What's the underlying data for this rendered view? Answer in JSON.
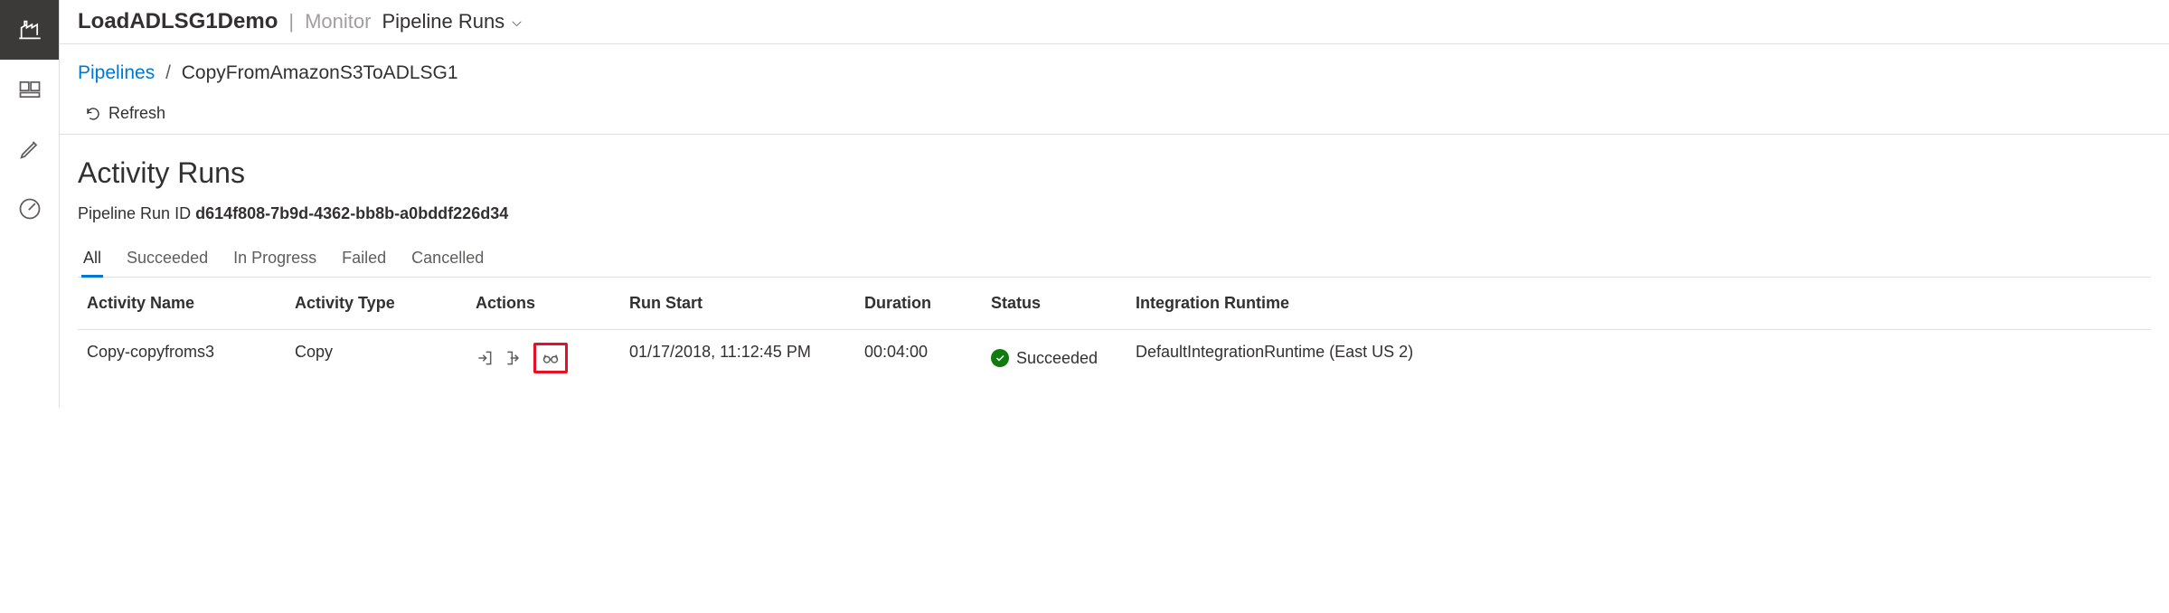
{
  "header": {
    "title": "LoadADLSG1Demo",
    "subtitle": "Monitor",
    "dropdown_label": "Pipeline Runs"
  },
  "breadcrumb": {
    "link": "Pipelines",
    "separator": "/",
    "current": "CopyFromAmazonS3ToADLSG1"
  },
  "toolbar": {
    "refresh_label": "Refresh"
  },
  "page": {
    "heading": "Activity Runs",
    "runid_label": "Pipeline Run ID",
    "runid_value": "d614f808-7b9d-4362-bb8b-a0bddf226d34"
  },
  "filters": {
    "tabs": [
      "All",
      "Succeeded",
      "In Progress",
      "Failed",
      "Cancelled"
    ],
    "active_index": 0
  },
  "table": {
    "headers": {
      "activity_name": "Activity Name",
      "activity_type": "Activity Type",
      "actions": "Actions",
      "run_start": "Run Start",
      "duration": "Duration",
      "status": "Status",
      "integration_runtime": "Integration Runtime"
    },
    "rows": [
      {
        "activity_name": "Copy-copyfroms3",
        "activity_type": "Copy",
        "run_start": "01/17/2018, 11:12:45 PM",
        "duration": "00:04:00",
        "status": "Succeeded",
        "integration_runtime": "DefaultIntegrationRuntime (East US 2)"
      }
    ]
  }
}
